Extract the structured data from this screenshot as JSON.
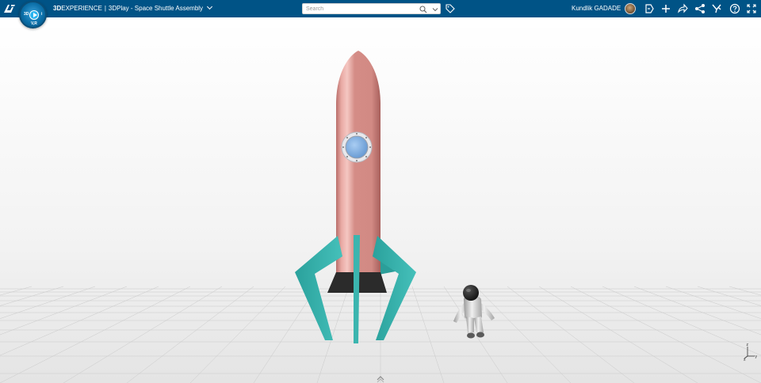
{
  "header": {
    "brand_bold": "3D",
    "brand_rest": "EXPERIENCE",
    "separator": "|",
    "app_title": "3DPlay - Space Shuttle Assembly",
    "compass_quadrant_left": "3D",
    "compass_quadrant_right": "i",
    "compass_quadrant_bottom": "V,R",
    "search_placeholder": "Search",
    "user_name": "Kundlik GADADE"
  },
  "toolbar_icons": [
    "share-location-icon",
    "add-icon",
    "share-icon",
    "network-icon",
    "tools-icon",
    "help-icon",
    "fullscreen-icon"
  ],
  "viewport": {
    "axis_x": "x",
    "axis_y": "y",
    "axis_z": "z"
  },
  "colors": {
    "topbar": "#005386",
    "rocket_body": "#d9958f",
    "fins": "#38b2ad",
    "nozzle": "#2b2b2b",
    "porthole": "#7fb3e6"
  }
}
